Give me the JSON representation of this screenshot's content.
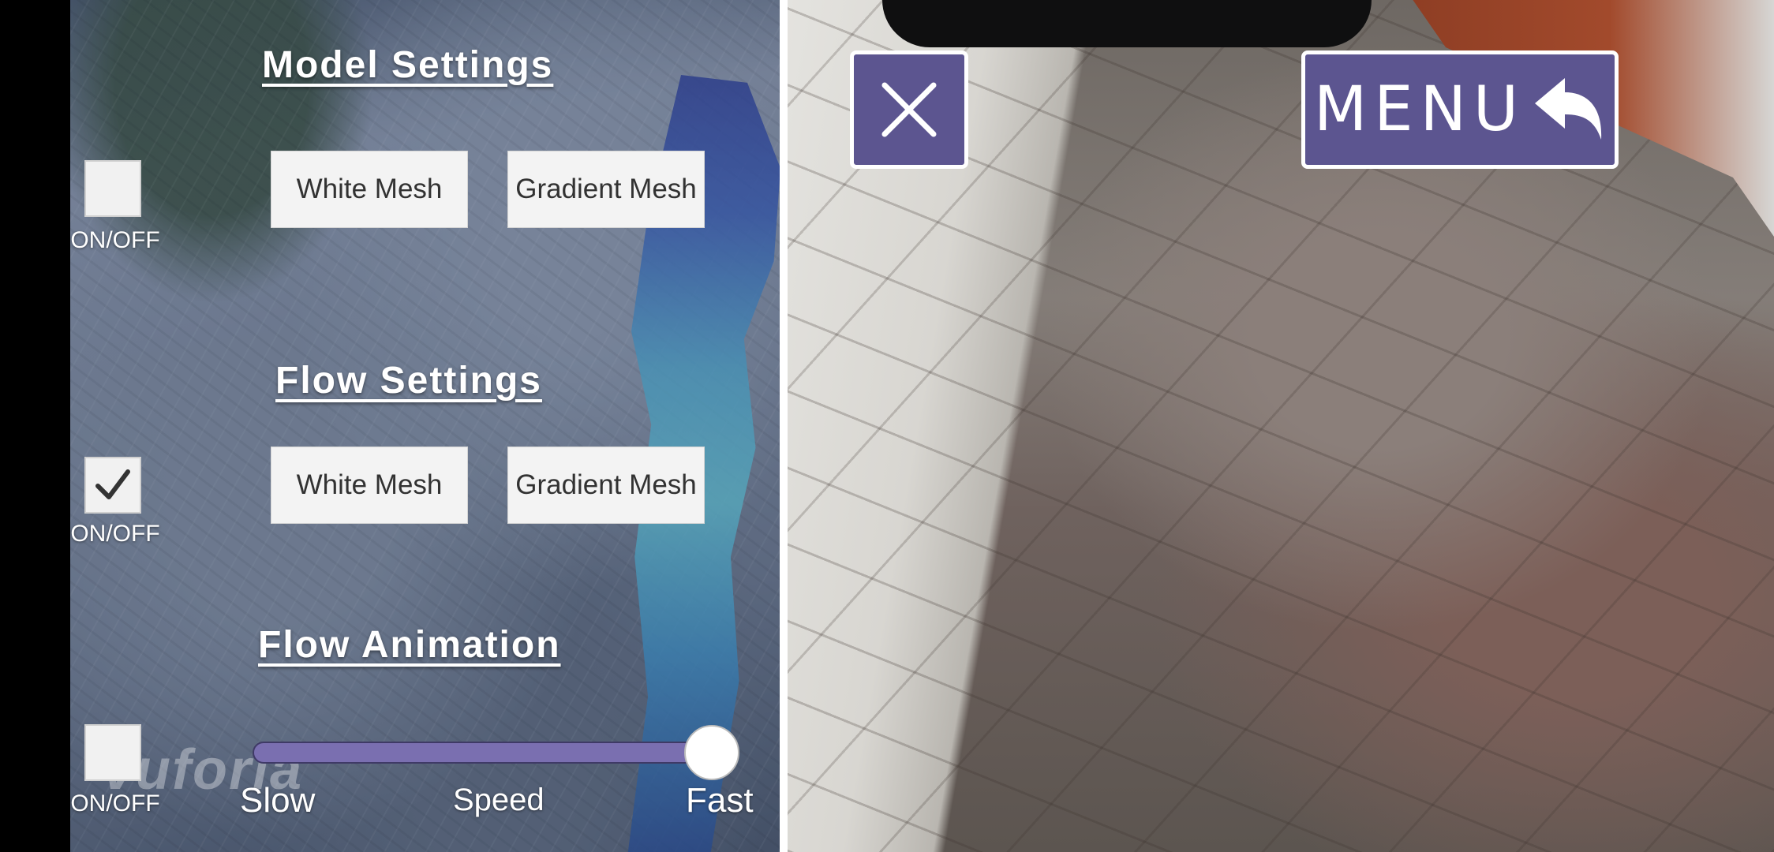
{
  "model_settings": {
    "title": "Model Settings",
    "toggle": {
      "label": "ON/OFF",
      "checked": false
    },
    "white_mesh_label": "White Mesh",
    "gradient_mesh_label": "Gradient Mesh"
  },
  "flow_settings": {
    "title": "Flow Settings",
    "toggle": {
      "label": "ON/OFF",
      "checked": true
    },
    "white_mesh_label": "White Mesh",
    "gradient_mesh_label": "Gradient Mesh"
  },
  "flow_animation": {
    "title": "Flow Animation",
    "toggle": {
      "label": "ON/OFF",
      "checked": false
    },
    "speed_slider": {
      "min_label": "Slow",
      "center_label": "Speed",
      "max_label": "Fast",
      "value_fraction": 1.0
    }
  },
  "watermark": "vuforia",
  "right_panel": {
    "close_icon": "close-icon",
    "menu_label": "MENU",
    "menu_icon": "reply-arrow-icon"
  },
  "colors": {
    "accent_purple": "#5c5590",
    "slider_track": "#7a6fb0",
    "button_bg": "#f3f3f3"
  }
}
